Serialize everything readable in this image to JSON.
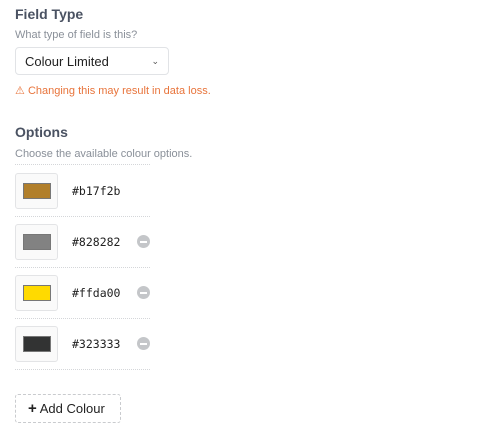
{
  "field_type": {
    "title": "Field Type",
    "description": "What type of field is this?",
    "selected": "Colour Limited",
    "warning": "Changing this may result in data loss."
  },
  "options": {
    "title": "Options",
    "description": "Choose the available colour options.",
    "colours": [
      {
        "hex": "#b17f2b",
        "removable": false
      },
      {
        "hex": "#828282",
        "removable": true
      },
      {
        "hex": "#ffda00",
        "removable": true
      },
      {
        "hex": "#323333",
        "removable": true
      }
    ],
    "add_label": "Add Colour"
  },
  "colors": {
    "warning": "#e8743b",
    "heading": "#4a5262"
  }
}
